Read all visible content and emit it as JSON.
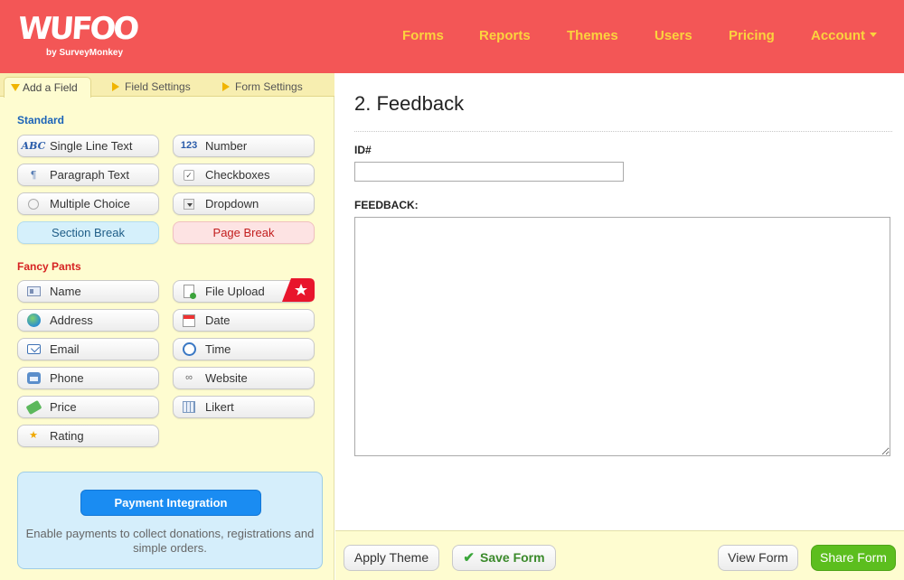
{
  "header": {
    "logo_text": "WUFOO",
    "logo_sub": "by SurveyMonkey",
    "nav": [
      "Forms",
      "Reports",
      "Themes",
      "Users",
      "Pricing",
      "Account"
    ]
  },
  "tabs": {
    "add_field": "Add a Field",
    "field_settings": "Field Settings",
    "form_settings": "Form Settings"
  },
  "standard": {
    "label": "Standard",
    "single_line": "Single Line Text",
    "number": "Number",
    "paragraph": "Paragraph Text",
    "checkboxes": "Checkboxes",
    "multiple_choice": "Multiple Choice",
    "dropdown": "Dropdown",
    "section_break": "Section Break",
    "page_break": "Page Break",
    "icon_abc": "ABC",
    "icon_123": "123"
  },
  "fancy": {
    "label": "Fancy Pants",
    "name": "Name",
    "file_upload": "File Upload",
    "address": "Address",
    "date": "Date",
    "email": "Email",
    "time": "Time",
    "phone": "Phone",
    "website": "Website",
    "price": "Price",
    "likert": "Likert",
    "rating": "Rating"
  },
  "payment": {
    "button": "Payment Integration",
    "text": "Enable payments to collect donations, registrations and simple orders."
  },
  "form": {
    "title": "2. Feedback",
    "id_label": "ID#",
    "id_value": "",
    "feedback_label": "FEEDBACK:",
    "feedback_value": ""
  },
  "bottom": {
    "apply_theme": "Apply Theme",
    "save_form": "Save Form",
    "view_form": "View Form",
    "share_form": "Share Form"
  },
  "colors": {
    "header_bg": "#f35656",
    "nav_text": "#fbd33e",
    "panel_bg": "#fefcd0",
    "payment_button": "#1a8cf2",
    "share_button": "#5cbe1e"
  }
}
